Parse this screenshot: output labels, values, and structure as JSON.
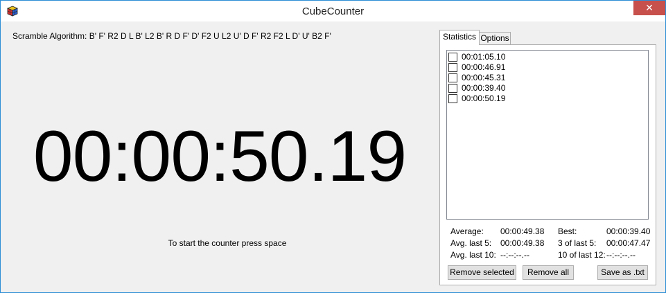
{
  "window": {
    "title": "CubeCounter",
    "close_label": "✕"
  },
  "scramble": {
    "text": "Scramble Algorithm: B' F' R2 D L B' L2 B' R D F' D' F2 U L2 U' D F' R2 F2 L D' U' B2 F'"
  },
  "timer": {
    "display": "00:00:50.19"
  },
  "hint": {
    "text": "To start the counter press space"
  },
  "tabs": [
    {
      "label": "Statistics",
      "active": true
    },
    {
      "label": "Options",
      "active": false
    }
  ],
  "times": [
    {
      "label": "00:01:05.10",
      "checked": false
    },
    {
      "label": "00:00:46.91",
      "checked": false
    },
    {
      "label": "00:00:45.31",
      "checked": false
    },
    {
      "label": "00:00:39.40",
      "checked": false
    },
    {
      "label": "00:00:50.19",
      "checked": false
    }
  ],
  "stats": {
    "average_label": "Average:",
    "average_value": "00:00:49.38",
    "best_label": "Best:",
    "best_value": "00:00:39.40",
    "avg5_label": "Avg. last 5:",
    "avg5_value": "00:00:49.38",
    "three5_label": "3 of last 5:",
    "three5_value": "00:00:47.47",
    "avg10_label": "Avg. last 10:",
    "avg10_value": "--:--:--.--",
    "ten12_label": "10 of last 12:",
    "ten12_value": "--:--:--.--"
  },
  "buttons": {
    "remove_selected": "Remove selected",
    "remove_all": "Remove all",
    "save_txt": "Save as .txt"
  }
}
